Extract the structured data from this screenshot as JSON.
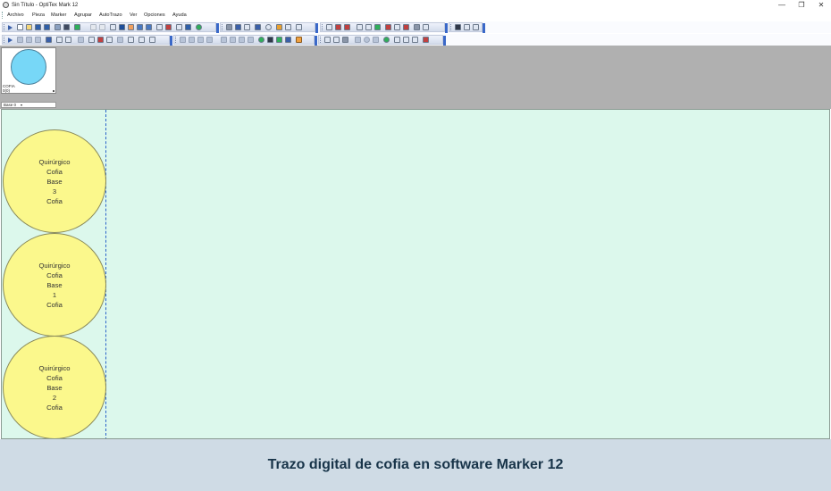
{
  "window": {
    "title": "Sin Título - OptiTex Mark 12",
    "controls": {
      "minimize": "—",
      "restore": "❐",
      "close": "✕"
    }
  },
  "menu": [
    "Archivo",
    "Pieza",
    "Marker",
    "Agrupar",
    "AutoTrazo",
    "Ver",
    "Opciones",
    "Ayuda"
  ],
  "colors": {
    "marker_background": "#dcf8ec",
    "piece_fill": "#fbf88c",
    "thumbnail_piece_fill": "#77d7f7",
    "workspace_gray": "#b0b0b0",
    "width_line": "#2b63c9"
  },
  "piece_bin": {
    "thumbnail": {
      "label": "COFIA",
      "count": "0(0)"
    },
    "base_selector": {
      "value": "Base 0"
    }
  },
  "marker": {
    "pieces": [
      {
        "lines": [
          "Quirúrgico",
          "Cofia",
          "Base",
          "3",
          "Cofia"
        ]
      },
      {
        "lines": [
          "Quirúrgico",
          "Cofia",
          "Base",
          "1",
          "Cofia"
        ]
      },
      {
        "lines": [
          "Quirúrgico",
          "Cofia",
          "Base",
          "2",
          "Cofia"
        ]
      }
    ]
  },
  "caption": "Trazo digital de cofia en software Marker 12"
}
